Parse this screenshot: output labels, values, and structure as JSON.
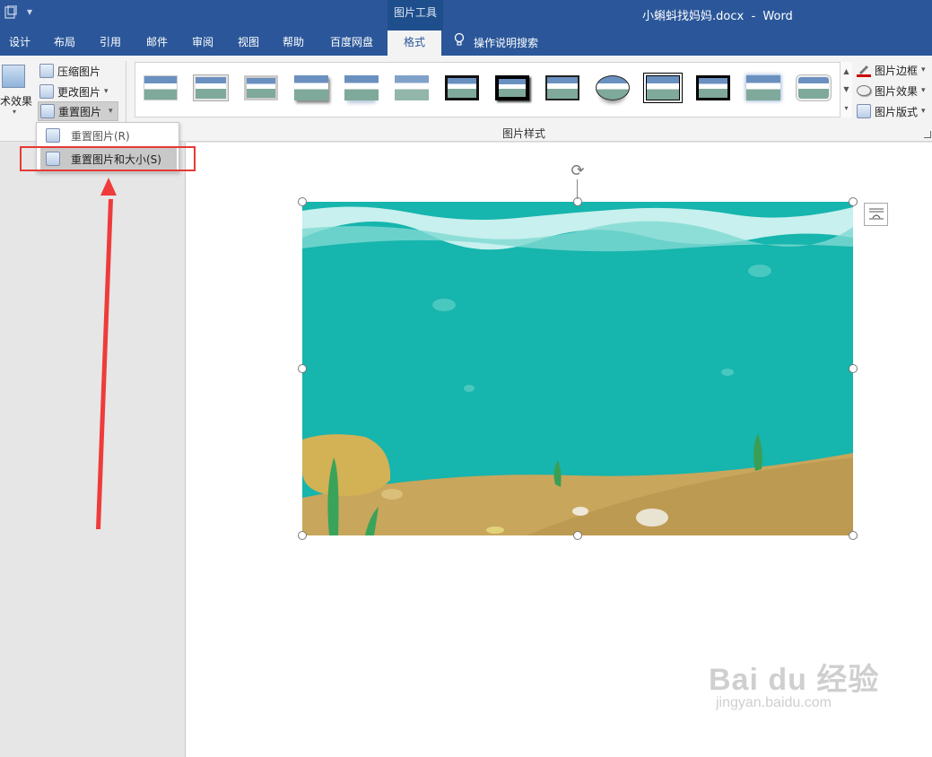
{
  "window": {
    "document_title": "小蝌蚪找妈妈.docx  -  Word",
    "context_tab_group": "图片工具"
  },
  "quick_access": {
    "save_icon": "document-icon",
    "customize_glyph": "▾"
  },
  "tabs": [
    {
      "label": "设计"
    },
    {
      "label": "布局"
    },
    {
      "label": "引用"
    },
    {
      "label": "邮件"
    },
    {
      "label": "审阅"
    },
    {
      "label": "视图"
    },
    {
      "label": "帮助"
    },
    {
      "label": "百度网盘"
    },
    {
      "label": "格式",
      "active": true
    }
  ],
  "tell_me": {
    "label": "操作说明搜索",
    "icon": "lightbulb-icon"
  },
  "adjust_group": {
    "artistic_effects": "术效果",
    "compress": "压缩图片",
    "change": "更改图片",
    "reset": "重置图片",
    "dropdown_glyph": "▾"
  },
  "styles_group": {
    "label": "图片样式",
    "border": "图片边框",
    "effects": "图片效果",
    "layout": "图片版式"
  },
  "reset_menu": {
    "items": [
      {
        "label": "重置图片(R)"
      },
      {
        "label": "重置图片和大小(S)",
        "hovered": true
      }
    ]
  },
  "watermark": {
    "main": "Bai du 经验",
    "sub": "jingyan.baidu.com"
  },
  "colors": {
    "ribbon_blue": "#2b579a",
    "highlight_red": "#e53935",
    "water": "#15b4ac",
    "sand": "#c8a65c"
  }
}
